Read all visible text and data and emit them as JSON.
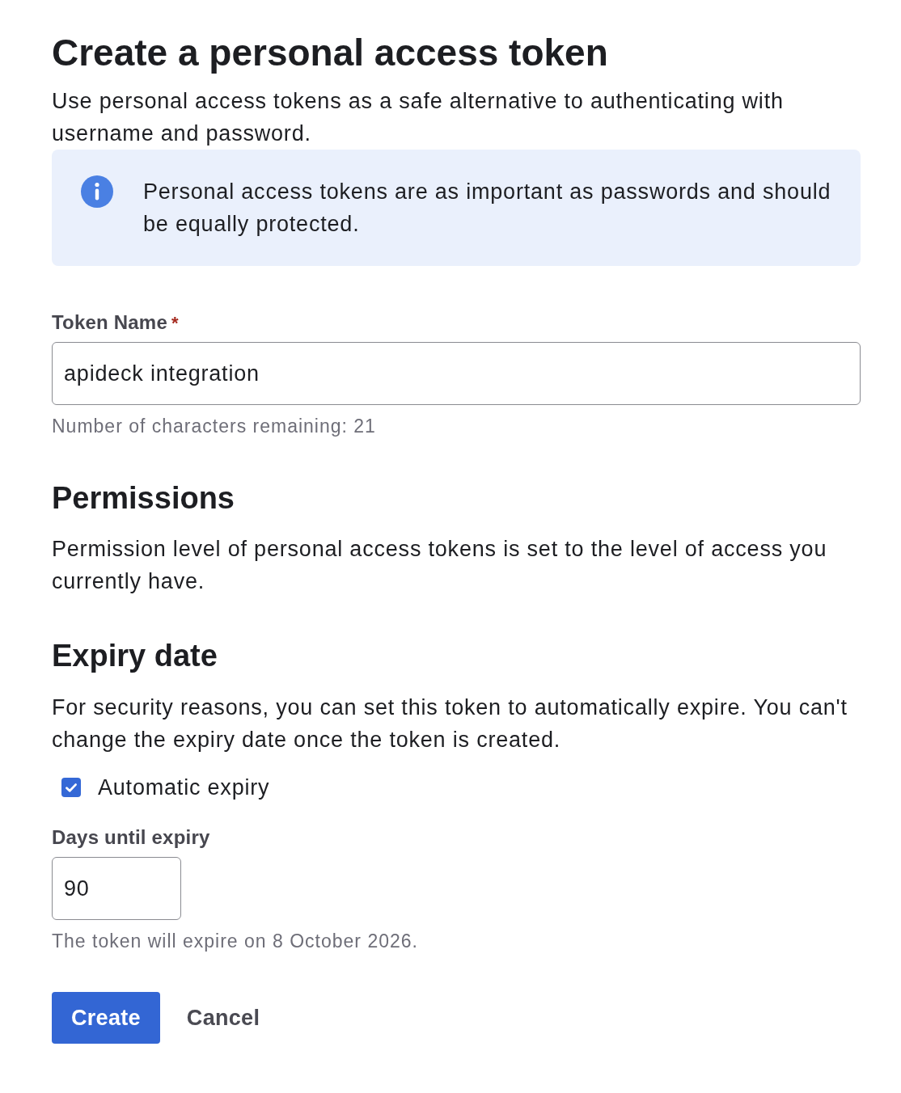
{
  "page": {
    "title": "Create a personal access token",
    "description": "Use personal access tokens as a safe alternative to authenticating with username and password."
  },
  "notice": {
    "kind": "info",
    "text": "Personal access tokens are as important as passwords and should be equally protected."
  },
  "token_name": {
    "label": "Token Name",
    "required_mark": "*",
    "value": "apideck integration",
    "hint": "Number of characters remaining: 21"
  },
  "permissions": {
    "heading": "Permissions",
    "text": "Permission level of personal access tokens is set to the level of access you currently have."
  },
  "expiry_date": {
    "heading": "Expiry date",
    "text": "For security reasons, you can set this token to automatically expire. You can't change the expiry date once the token is created.",
    "automatic_expiry": {
      "label": "Automatic expiry",
      "checked": true
    },
    "days_until_expiry": {
      "label": "Days until expiry",
      "value": "90",
      "hint": "The token will expire on 8 October 2026."
    }
  },
  "buttons": [
    {
      "label": "Create",
      "kind": "primary"
    },
    {
      "label": "Cancel",
      "kind": "plain"
    }
  ]
}
